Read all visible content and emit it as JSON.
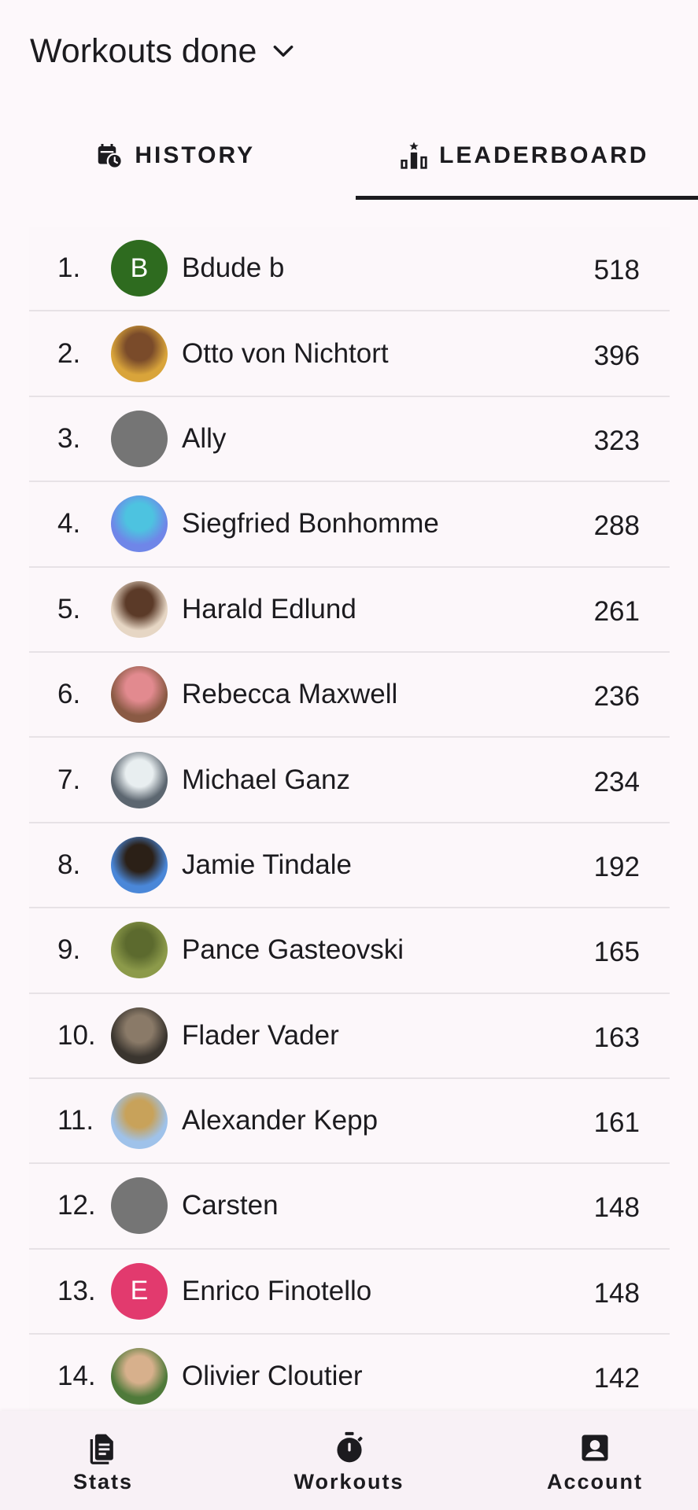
{
  "header": {
    "title": "Workouts done"
  },
  "tabs": [
    {
      "label": "HISTORY",
      "icon": "calendar-clock-icon"
    },
    {
      "label": "LEADERBOARD",
      "icon": "leaderboard-icon"
    }
  ],
  "leaderboard": [
    {
      "rank": "1.",
      "name": "Bdude b",
      "score": "518",
      "avatar": {
        "type": "initial",
        "letter": "B",
        "color": "#2e6b1f"
      }
    },
    {
      "rank": "2.",
      "name": "Otto von Nichtort",
      "score": "396",
      "avatar": {
        "type": "photo",
        "colors": [
          "#d9a43a",
          "#7a4b2a"
        ]
      }
    },
    {
      "rank": "3.",
      "name": "Ally",
      "score": "323",
      "avatar": {
        "type": "placeholder",
        "color": "#757575"
      }
    },
    {
      "rank": "4.",
      "name": "Siegfried Bonhomme",
      "score": "288",
      "avatar": {
        "type": "photo",
        "colors": [
          "#6f86e8",
          "#4dc3e0"
        ]
      }
    },
    {
      "rank": "5.",
      "name": "Harald Edlund",
      "score": "261",
      "avatar": {
        "type": "photo",
        "colors": [
          "#e6d6c4",
          "#5b3a28"
        ]
      }
    },
    {
      "rank": "6.",
      "name": "Rebecca Maxwell",
      "score": "236",
      "avatar": {
        "type": "photo",
        "colors": [
          "#8a5a44",
          "#e28a8f"
        ]
      }
    },
    {
      "rank": "7.",
      "name": "Michael Ganz",
      "score": "234",
      "avatar": {
        "type": "photo",
        "colors": [
          "#5c6670",
          "#e8eef0"
        ]
      }
    },
    {
      "rank": "8.",
      "name": "Jamie Tindale",
      "score": "192",
      "avatar": {
        "type": "photo",
        "colors": [
          "#4a87d8",
          "#2b2017"
        ]
      }
    },
    {
      "rank": "9.",
      "name": "Pance Gasteovski",
      "score": "165",
      "avatar": {
        "type": "photo",
        "colors": [
          "#8c9a4a",
          "#5c6a2e"
        ]
      }
    },
    {
      "rank": "10.",
      "name": "Flader Vader",
      "score": "163",
      "avatar": {
        "type": "photo",
        "colors": [
          "#3a352f",
          "#8a7a68"
        ]
      }
    },
    {
      "rank": "11.",
      "name": "Alexander Kepp",
      "score": "161",
      "avatar": {
        "type": "photo",
        "colors": [
          "#9fc2ea",
          "#c8a25a"
        ]
      }
    },
    {
      "rank": "12.",
      "name": "Carsten",
      "score": "148",
      "avatar": {
        "type": "placeholder",
        "color": "#757575"
      }
    },
    {
      "rank": "13.",
      "name": "Enrico Finotello",
      "score": "148",
      "avatar": {
        "type": "initial",
        "letter": "E",
        "color": "#e23a6e"
      }
    },
    {
      "rank": "14.",
      "name": "Olivier Cloutier",
      "score": "142",
      "avatar": {
        "type": "photo",
        "colors": [
          "#4f7a3a",
          "#d7b08c"
        ]
      }
    }
  ],
  "bottom_nav": [
    {
      "label": "Stats",
      "icon": "clipboard-icon"
    },
    {
      "label": "Workouts",
      "icon": "stopwatch-icon"
    },
    {
      "label": "Account",
      "icon": "account-box-icon"
    }
  ]
}
